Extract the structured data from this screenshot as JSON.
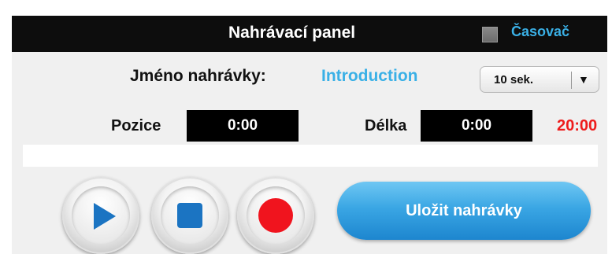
{
  "header": {
    "title": "Nahrávací panel",
    "timer_label": "Časovač",
    "timer_checked": false
  },
  "recording": {
    "name_label": "Jméno nahrávky:",
    "name_value": "Introduction",
    "interval_select": {
      "selected": "10 sek."
    }
  },
  "position": {
    "label": "Pozice",
    "value": "0:00"
  },
  "length": {
    "label": "Délka",
    "value": "0:00",
    "total": "20:00"
  },
  "progress": {
    "value": 0
  },
  "controls": {
    "play": "play-icon",
    "stop": "stop-icon",
    "record": "record-icon",
    "save_label": "Uložit nahrávky"
  },
  "colors": {
    "accent": "#3ab0e6",
    "header_bg": "#0d0d0d",
    "total_time": "#ee1c1c",
    "play_icon": "#1b74c2",
    "stop_icon": "#1b74c2",
    "record_icon": "#f0141e"
  }
}
